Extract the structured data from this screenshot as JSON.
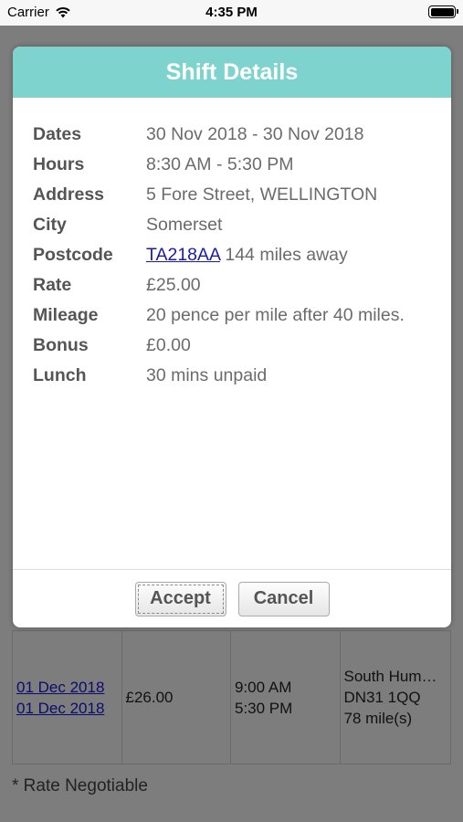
{
  "status_bar": {
    "carrier": "Carrier",
    "time": "4:35 PM"
  },
  "modal": {
    "title": "Shift Details",
    "rows": [
      {
        "label": "Dates",
        "value": "30 Nov 2018 - 30 Nov 2018"
      },
      {
        "label": "Hours",
        "value": "8:30 AM - 5:30 PM"
      },
      {
        "label": "Address",
        "value": "5 Fore Street, WELLINGTON"
      },
      {
        "label": "City",
        "value": "Somerset"
      },
      {
        "label": "Postcode",
        "link": "TA218AA",
        "value": " 144 miles away"
      },
      {
        "label": "Rate",
        "value": "£25.00"
      },
      {
        "label": "Mileage",
        "value": "20 pence per mile after 40 miles."
      },
      {
        "label": "Bonus",
        "value": "£0.00"
      },
      {
        "label": "Lunch",
        "value": "30 mins unpaid"
      }
    ],
    "accept_label": "Accept",
    "cancel_label": "Cancel"
  },
  "background": {
    "row": {
      "date_start": "01 Dec 2018",
      "date_end": "01 Dec 2018",
      "rate": "£26.00",
      "time_start": "9:00 AM",
      "time_end": "5:30 PM",
      "location": "South Hum…",
      "postcode": "DN31 1QQ",
      "distance": "78 mile(s)"
    },
    "rate_note": "* Rate Negotiable"
  }
}
